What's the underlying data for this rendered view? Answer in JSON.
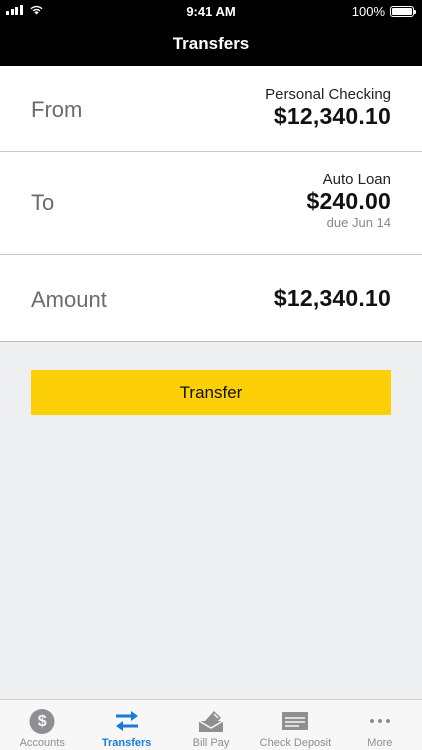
{
  "status": {
    "time": "9:41 AM",
    "battery": "100%"
  },
  "nav": {
    "title": "Transfers"
  },
  "from": {
    "label": "From",
    "account": "Personal Checking",
    "amount": "$12,340.10"
  },
  "to": {
    "label": "To",
    "account": "Auto Loan",
    "amount": "$240.00",
    "due": "due Jun 14"
  },
  "amount": {
    "label": "Amount",
    "value": "$12,340.10"
  },
  "transfer_button": {
    "label": "Transfer"
  },
  "tabs": [
    {
      "label": "Accounts",
      "icon": "dollar-circle-icon"
    },
    {
      "label": "Transfers",
      "icon": "transfer-arrows-icon"
    },
    {
      "label": "Bill Pay",
      "icon": "envelope-bill-icon"
    },
    {
      "label": "Check Deposit",
      "icon": "check-icon"
    },
    {
      "label": "More",
      "icon": "more-dots-icon"
    }
  ],
  "colors": {
    "accent": "#1a7ad9",
    "button": "#fccf06",
    "nav": "#000000"
  }
}
